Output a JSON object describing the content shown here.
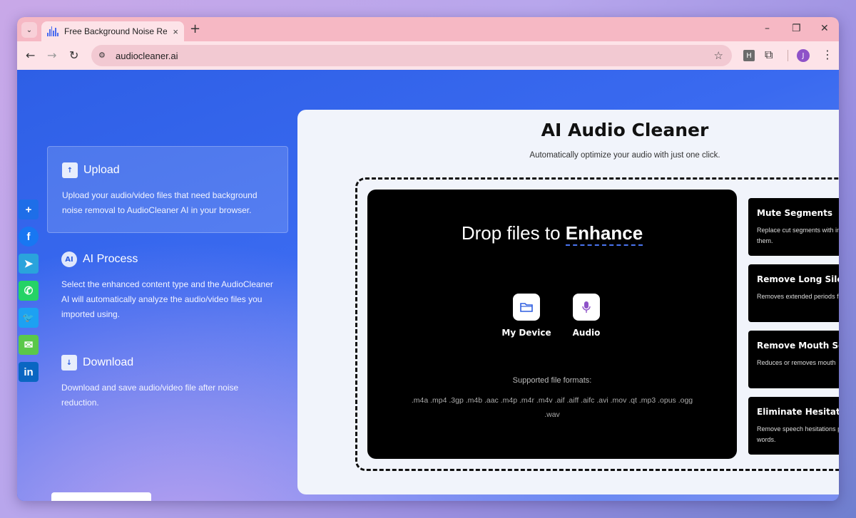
{
  "browser": {
    "tab_title": "Free Background Noise Remove",
    "tab_close": "×",
    "new_tab": "+",
    "url": "audiocleaner.ai",
    "profile_initial": "J",
    "extension_label": "H",
    "window_controls": [
      "–",
      "❐",
      "✕"
    ]
  },
  "share": [
    {
      "icon": "plus-icon",
      "glyph": "+",
      "color": "#1e6ee8"
    },
    {
      "icon": "facebook-icon",
      "glyph": "f",
      "color": "#1877f2"
    },
    {
      "icon": "telegram-icon",
      "glyph": "➤",
      "color": "#2aa3dc"
    },
    {
      "icon": "whatsapp-icon",
      "glyph": "✆",
      "color": "#25d366"
    },
    {
      "icon": "twitter-icon",
      "glyph": "🐦",
      "color": "#1da1f2"
    },
    {
      "icon": "wechat-icon",
      "glyph": "✉",
      "color": "#5ac84a"
    },
    {
      "icon": "linkedin-icon",
      "glyph": "in",
      "color": "#0a66c2"
    }
  ],
  "steps": [
    {
      "title": "Upload",
      "desc": "Upload your audio/video files that need background noise removal to AudioCleaner AI in your browser."
    },
    {
      "title": "AI Process",
      "icon_text": "AI",
      "desc": "Select the enhanced content type and the AudioCleaner AI will automatically analyze the audio/video files you imported using."
    },
    {
      "title": "Download",
      "desc": "Download and save audio/video file after noise reduction."
    }
  ],
  "main": {
    "title": "AI Audio Cleaner",
    "subtitle": "Automatically optimize your audio with just one click.",
    "drop_prefix": "Drop files to",
    "drop_emphasis": "Enhance",
    "source_device": "My Device",
    "source_audio": "Audio",
    "formats_title": "Supported file formats:",
    "formats_line1": ".m4a .mp4 .3gp .m4b .aac .m4p .m4r .m4v .aif .aiff .aifc .avi .mov .qt .mp3 .opus .ogg",
    "formats_line2": ".wav"
  },
  "options": [
    {
      "title": "Mute Segments",
      "desc": "Replace cut segments with instead of removing them."
    },
    {
      "title": "Remove Long Sile",
      "desc": "Removes extended periods from the audio."
    },
    {
      "title": "Remove Mouth So",
      "desc": "Reduces or removes mouth"
    },
    {
      "title": "Eliminate Hesitati",
      "desc": "Remove speech hesitations pauses or repeated words."
    }
  ]
}
